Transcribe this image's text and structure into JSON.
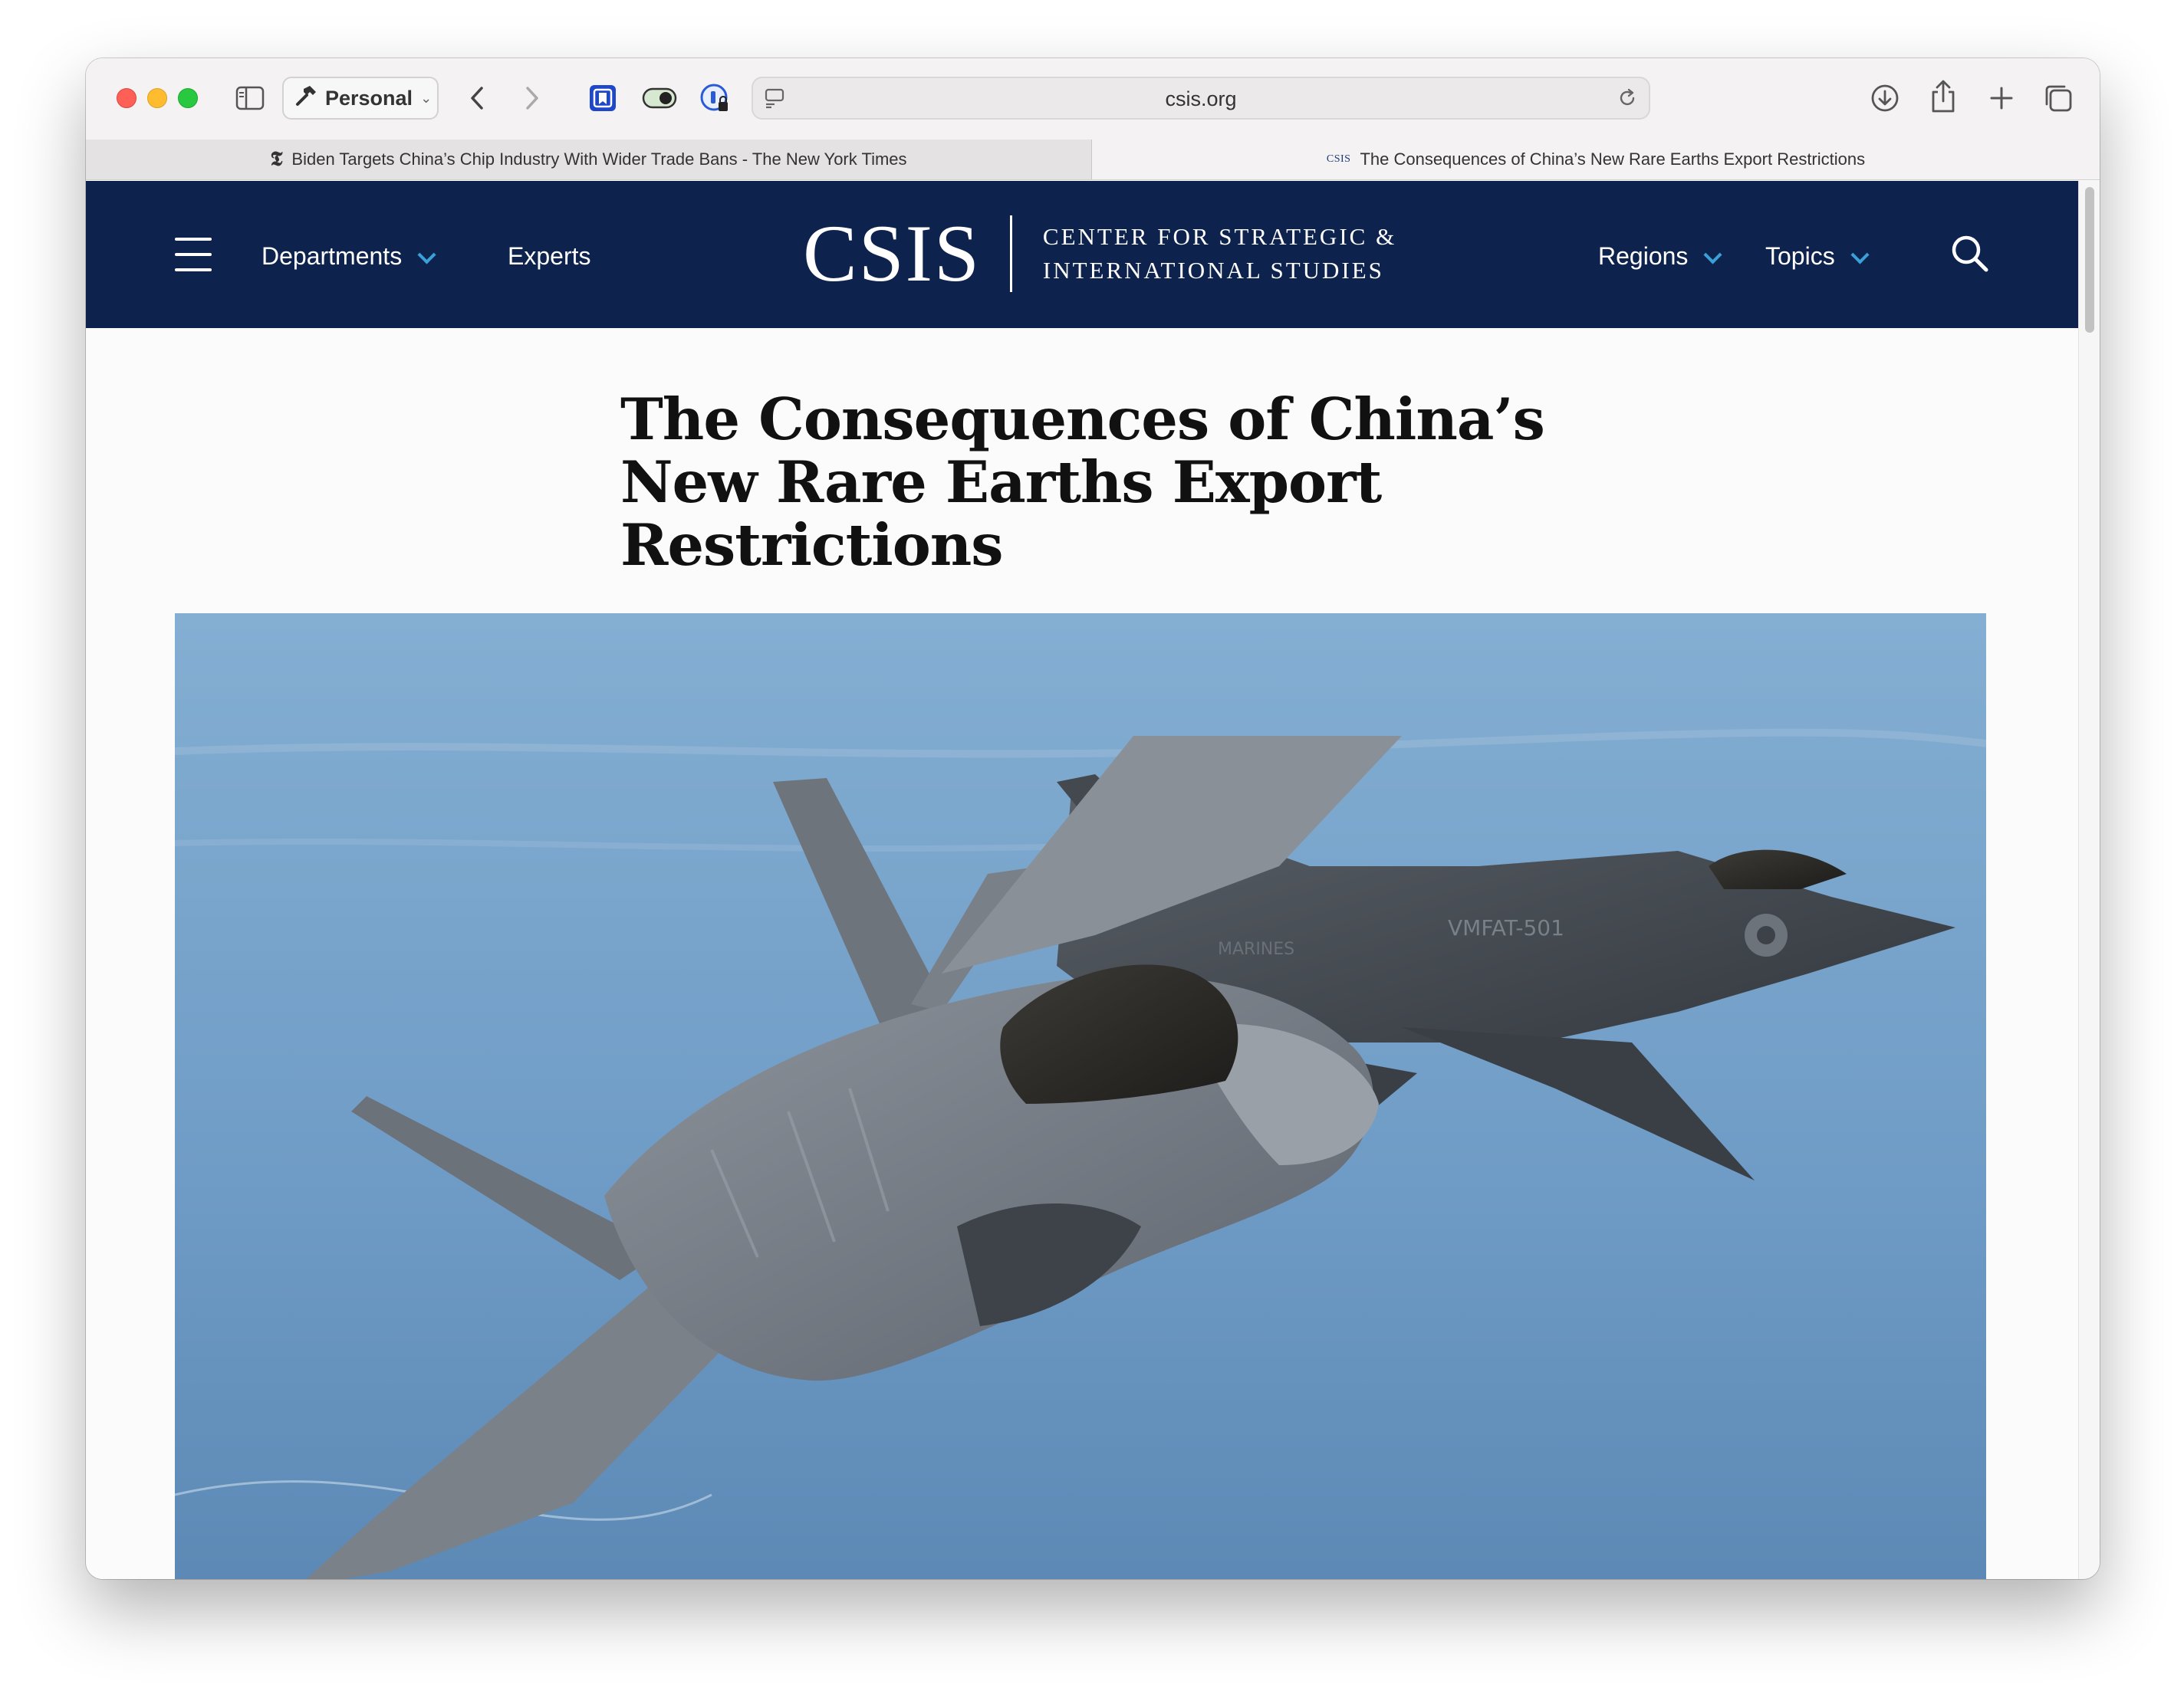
{
  "browser": {
    "profile_label": "Personal",
    "address_url": "csis.org",
    "tabs": [
      {
        "label": "Biden Targets China’s Chip Industry With Wider Trade Bans - The New York Times",
        "favicon": "𝕿"
      },
      {
        "label": "The Consequences of China’s New Rare Earths Export Restrictions",
        "favicon": "CSIS"
      }
    ]
  },
  "site_nav": {
    "departments_label": "Departments",
    "experts_label": "Experts",
    "logo_word": "CSIS",
    "logo_line1": "CENTER FOR STRATEGIC &",
    "logo_line2": "INTERNATIONAL STUDIES",
    "regions_label": "Regions",
    "topics_label": "Topics"
  },
  "article": {
    "title": "The Consequences of China’s New Rare Earths Export Restrictions",
    "hero_image_alt": "Two F-35 fighter jets flying over the ocean",
    "hero_jet_markings": {
      "tail": "VMFAT-501",
      "marines": "MARINES"
    }
  },
  "colors": {
    "nav_background": "#0d234d",
    "chevron_accent": "#3aa0d8",
    "sky_top": "#7ea9cd",
    "sky_bottom": "#5d88b4"
  }
}
